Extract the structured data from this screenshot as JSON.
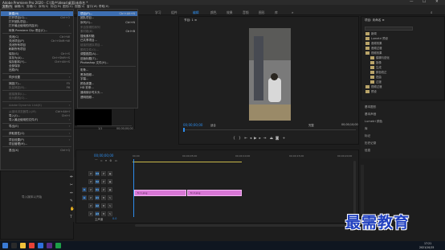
{
  "titlebar": {
    "title": "Adobe Premiere Pro 2020 - C:\\用户\\Ideas\\桌面\\未命名 *",
    "minimize": "—",
    "maximize": "☐",
    "close": "✕"
  },
  "menubar": {
    "items": [
      "文件(F)",
      "编辑(E)",
      "剪辑(C)",
      "序列(S)",
      "标记(M)",
      "图形(G)",
      "视图(V)",
      "窗口(W)",
      "帮助(H)"
    ]
  },
  "workspaces": [
    "学习",
    "组件",
    "编辑",
    "颜色",
    "效果",
    "音频",
    "图形",
    "库"
  ],
  "file_menu": {
    "items": [
      {
        "label": "新建(N)",
        "shortcut": "",
        "sub": true,
        "sel": true
      },
      {
        "label": "打开项目(O)...",
        "shortcut": "Ctrl+O"
      },
      {
        "label": "打开团队项目...",
        "shortcut": ""
      },
      {
        "label": "打开最近使用的内容(E)",
        "shortcut": "",
        "sub": true
      },
      {
        "label": "转换 Premiere Clip 项目(C)...",
        "shortcut": ""
      },
      {
        "sep": true
      },
      {
        "label": "关闭(C)",
        "shortcut": "Ctrl+W"
      },
      {
        "label": "关闭项目(P)",
        "shortcut": "Ctrl+Shift+W"
      },
      {
        "label": "关闭所有项目",
        "shortcut": ""
      },
      {
        "label": "刷新所有项目",
        "shortcut": ""
      },
      {
        "label": "保存(S)",
        "shortcut": "Ctrl+S"
      },
      {
        "label": "另存为(A)...",
        "shortcut": "Ctrl+Shift+S"
      },
      {
        "label": "保存副本(Y)...",
        "shortcut": "Ctrl+Alt+S"
      },
      {
        "label": "全部保存",
        "shortcut": ""
      },
      {
        "label": "还原(R)",
        "shortcut": ""
      },
      {
        "sep": true
      },
      {
        "label": "同步设置",
        "shortcut": "",
        "sub": true
      },
      {
        "sep": true
      },
      {
        "label": "捕捉(T)...",
        "shortcut": "F5"
      },
      {
        "label": "批量捕捉(B)...",
        "shortcut": "F6",
        "dis": true
      },
      {
        "sep": true
      },
      {
        "label": "链接媒体(L)...",
        "shortcut": "",
        "dis": true
      },
      {
        "label": "设为脱机(O)...",
        "shortcut": "",
        "dis": true
      },
      {
        "sep": true
      },
      {
        "label": "Adobe Dynamic Link(K)",
        "shortcut": "",
        "sub": true,
        "dis": true
      },
      {
        "sep": true
      },
      {
        "label": "从媒体浏览器导入(M)",
        "shortcut": "Ctrl+Alt+I",
        "dis": true
      },
      {
        "label": "导入(I)...",
        "shortcut": "Ctrl+I"
      },
      {
        "label": "导入最近使用的文件(F)",
        "shortcut": "",
        "sub": true
      },
      {
        "sep": true
      },
      {
        "label": "导出(E)",
        "shortcut": "",
        "sub": true
      },
      {
        "sep": true
      },
      {
        "label": "获取属性(G)",
        "shortcut": "",
        "sub": true
      },
      {
        "sep": true
      },
      {
        "label": "项目设置(P)",
        "shortcut": "",
        "sub": true
      },
      {
        "label": "项目管理(M)...",
        "shortcut": ""
      },
      {
        "sep": true
      },
      {
        "label": "退出(X)",
        "shortcut": "Ctrl+Q"
      }
    ]
  },
  "new_submenu": {
    "items": [
      {
        "label": "项目(P)...",
        "shortcut": "Ctrl+Alt+N",
        "sel": true
      },
      {
        "label": "团队项目...",
        "shortcut": ""
      },
      {
        "label": "序列(S)...",
        "shortcut": "Ctrl+N"
      },
      {
        "label": "来自剪辑的序列",
        "shortcut": "",
        "dis": true
      },
      {
        "label": "素材箱(B)",
        "shortcut": "Ctrl+B",
        "dis": true
      },
      {
        "label": "搜索素材箱",
        "shortcut": ""
      },
      {
        "label": "已共享项目...",
        "shortcut": ""
      },
      {
        "label": "链接的团队项目...",
        "shortcut": "",
        "dis": true
      },
      {
        "label": "脱机文件(O)...",
        "shortcut": "",
        "dis": true
      },
      {
        "label": "调整图层(A)...",
        "shortcut": ""
      },
      {
        "label": "旧版标题(T)...",
        "shortcut": ""
      },
      {
        "label": "Photoshop 文件(H)...",
        "shortcut": ""
      },
      {
        "sep": true
      },
      {
        "label": "彩条...",
        "shortcut": ""
      },
      {
        "label": "黑场视频...",
        "shortcut": ""
      },
      {
        "label": "字幕...",
        "shortcut": ""
      },
      {
        "label": "颜色遮罩...",
        "shortcut": ""
      },
      {
        "label": "HD 彩条...",
        "shortcut": ""
      },
      {
        "label": "通用倒计时片头...",
        "shortcut": ""
      },
      {
        "label": "透明视频...",
        "shortcut": ""
      }
    ]
  },
  "program_monitor": {
    "tab": "节目: 1 ≡",
    "timecode": "00;00;00;00",
    "fit": "适合",
    "quality": "完整",
    "end_timecode": "00;00;10;00"
  },
  "source_monitor": {
    "page": "1/1",
    "timecode": "00;00;00;00"
  },
  "timeline": {
    "timecode": "00;00;00;00",
    "ruler": [
      "00;00",
      "00;00;05;00",
      "00;00;10;00",
      "00;00;15;00",
      "00;00;20;00"
    ],
    "tracks": [
      {
        "id": "V3"
      },
      {
        "id": "V2"
      },
      {
        "id": "V1"
      },
      {
        "id": "A1"
      },
      {
        "id": "A2"
      },
      {
        "id": "A3"
      }
    ],
    "master": "主声道",
    "master_val": "0.0",
    "clips": [
      {
        "label": "fx 1.png"
      },
      {
        "label": "fx 2.png"
      }
    ]
  },
  "project_panel": {
    "tab": "项目: 未命名 ≡",
    "search": "",
    "items": [
      "新闻",
      "Lumetri 预设",
      "音频效果",
      "音频过渡",
      "视频效果",
      "模糊与锐化",
      "抠像",
      "生成",
      "颜色校正",
      "扭曲",
      "过渡",
      "视频过渡",
      "预设"
    ]
  },
  "right_panels": [
    "基本图形",
    "基本声音",
    "Lumetri 颜色",
    "库",
    "标记",
    "历史记录",
    "信息"
  ],
  "media_browser": {
    "hint": "导入媒体以开始"
  },
  "taskbar": {
    "time": "17:21",
    "date": "2021/10/15"
  },
  "watermark": "最需教育"
}
